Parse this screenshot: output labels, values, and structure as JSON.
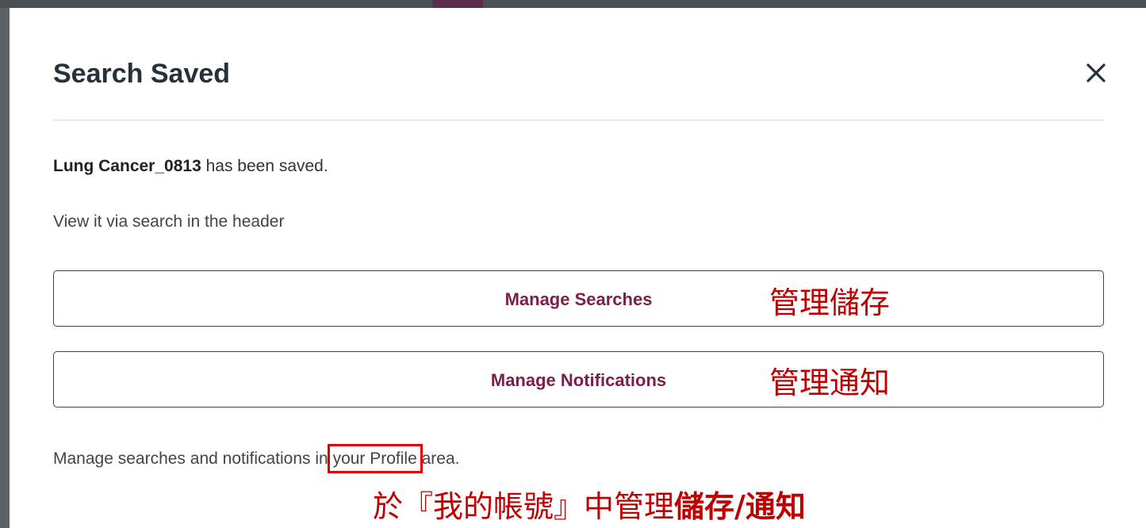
{
  "modal": {
    "title": "Search Saved",
    "close_icon": "close-icon",
    "saved_name": "Lung Cancer_0813",
    "saved_suffix": " has been saved.",
    "hint": "View it via search in the header",
    "footer_prefix": "Manage searches and notifications in ",
    "footer_link": "your Profile",
    "footer_suffix": " area."
  },
  "buttons": {
    "manage_searches": "Manage Searches",
    "manage_notifications": "Manage Notifications"
  },
  "annotations": {
    "manage_searches_zh": "管理儲存",
    "manage_notifications_zh": "管理通知",
    "footer_zh_prefix": "於『我的帳號』中管理",
    "footer_zh_bold": "儲存/通知"
  },
  "colors": {
    "accent": "#7b1f48",
    "annotation": "#c00000",
    "title": "#263238"
  }
}
